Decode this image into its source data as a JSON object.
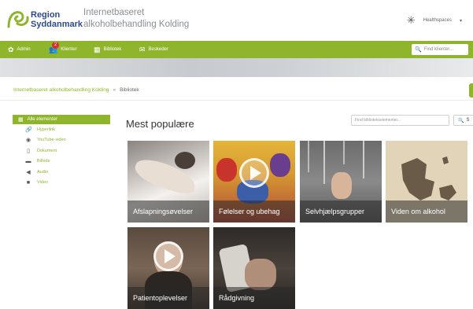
{
  "header": {
    "logo_line1": "Region",
    "logo_line2": "Syddanmark",
    "site_title_line1": "Internetbaseret",
    "site_title_line2": "alkoholbehandling Kolding",
    "user_label": "Healthspaces"
  },
  "nav": {
    "admin": "Admin",
    "klienter": "Klienter",
    "klienter_badge": "2",
    "bibliotek": "Bibliotek",
    "beskeder": "Beskeder",
    "search_placeholder": "Find klienter..."
  },
  "breadcrumb": {
    "home": "Internetbaseret alkoholbehandling Kolding",
    "separator": "»",
    "current": "Bibliotek"
  },
  "sidebar": {
    "header": "Alle elementer",
    "items": [
      {
        "label": "Hyperlink",
        "icon": "link-icon"
      },
      {
        "label": "YouTube-video",
        "icon": "youtube-icon"
      },
      {
        "label": "Dokument",
        "icon": "document-icon"
      },
      {
        "label": "Billede",
        "icon": "image-icon"
      },
      {
        "label": "Audio",
        "icon": "audio-icon"
      },
      {
        "label": "Video",
        "icon": "video-icon"
      }
    ]
  },
  "main": {
    "title": "Mest populære",
    "search_placeholder": "Find bibliotekselementer...",
    "search_button": "S",
    "tiles": [
      {
        "label": "Afslapningsøvelser"
      },
      {
        "label": "Følelser og ubehag"
      },
      {
        "label": "Selvhjælpsgrupper"
      },
      {
        "label": "Viden om alkohol"
      },
      {
        "label": "Patientoplevelser"
      },
      {
        "label": "Rådgivning"
      }
    ]
  },
  "colors": {
    "accent": "#8fb52c",
    "badge": "#d9302e",
    "logo_blue": "#2b4a8c"
  }
}
